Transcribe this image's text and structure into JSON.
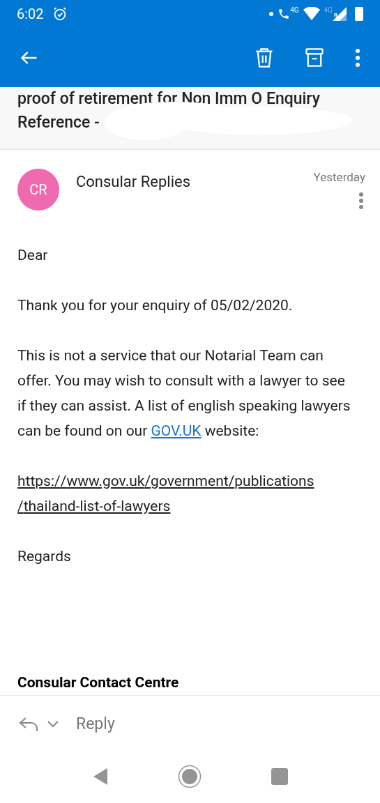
{
  "status_bar": {
    "time": "6:02",
    "call_network": "4G",
    "signal_network": "4G",
    "signal_roaming": "R"
  },
  "subject": {
    "lines": [
      "proof of retirement for Non Imm O Enquiry",
      "Reference -"
    ]
  },
  "message": {
    "avatar_initials": "CR",
    "sender": "Consular Replies",
    "date": "Yesterday",
    "body": [
      {
        "kind": "text",
        "text": "Dear"
      },
      {
        "kind": "text",
        "text": "Thank you for your enquiry of 05/02/2020."
      },
      {
        "kind": "text_with_link",
        "before": "This is not a service that our Notarial Team can offer. You may wish to consult with a lawyer to see if they can assist. A list of english speaking lawyers can be found on our",
        "link": "GOV.UK",
        "after": "website:"
      },
      {
        "kind": "url",
        "text": "https://www.gov.uk/government/publications/thailand-list-of-lawyers"
      },
      {
        "kind": "text",
        "text": "Regards"
      },
      {
        "kind": "signature",
        "text": "Consular Contact Centre"
      }
    ]
  },
  "reply_bar": {
    "label": "Reply"
  }
}
